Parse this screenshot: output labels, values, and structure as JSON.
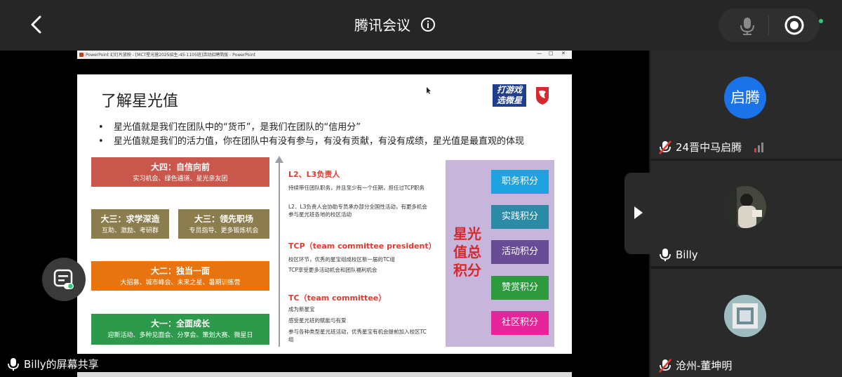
{
  "header": {
    "title": "腾讯会议"
  },
  "share_label": "Billy的屏幕共享",
  "ppt": {
    "window_title": "PowerPoint 幻灯片放映 - [MCT星光营2025招生-45-1105班]活动招聘简版 - PowerPoint",
    "slide": {
      "title": "了解星光值",
      "bullets": [
        "星光值就是我们在团队中的“货币”，是我们在团队的“信用分”",
        "星光值就是我们的活力值，你在团队中有没有参与，有没有贡献，有没有成绩，星光值是最直观的体现"
      ],
      "brand_text": [
        "打游戏",
        "选微星"
      ],
      "stages": [
        {
          "title": "大四：自信向前",
          "desc": "实习机会、绿色通道、星光亲友团",
          "color": "#c9574b"
        },
        {
          "title": "大三：求学深造",
          "desc": "互助、激励、考研群",
          "color": "#8c7d4e"
        },
        {
          "title": "大三：领先职场",
          "desc": "专员指导、更多锻炼机会",
          "color": "#8c7d4e"
        },
        {
          "title": "大二：独当一面",
          "desc": "大招募、城市峰会、未来之星、暑期训练营",
          "color": "#e8740f"
        },
        {
          "title": "大一：全面成长",
          "desc": "迎新活动、多种见面会、分享会、策划大赛、微星日",
          "color": "#2d9a4b"
        }
      ],
      "levels": [
        {
          "heading": "L2、L3负责人",
          "lines": [
            "持续带任团队职务，并且至少有一个任期，担任过TCP职务",
            "L2、L3负责人会协助专员承办部分全国性活动，有更多机会参与星光班各地的校区活动"
          ]
        },
        {
          "heading": "TCP（team committee president）",
          "lines": [
            "校区环节，优秀的星宝组成校区新一届的TC组",
            "TCP享受更多活动机会和团队福利机会"
          ]
        },
        {
          "heading": "TC（team committee）",
          "lines": [
            "成为新星宝",
            "感受星光班的赋能与有爱",
            "参与各种类型星光班活动，优秀星宝有机会提前加入校区TC组"
          ]
        }
      ],
      "panel_title": "星光值总积分",
      "points": [
        {
          "label": "职务积分",
          "color": "#1fa3e0"
        },
        {
          "label": "实践积分",
          "color": "#2b8aa6"
        },
        {
          "label": "活动积分",
          "color": "#6a4c96"
        },
        {
          "label": "赞赏积分",
          "color": "#2e9a3e"
        },
        {
          "label": "社区积分",
          "color": "#e6259a"
        }
      ]
    }
  },
  "participants": [
    {
      "name": "24晋中马启腾",
      "avatar_text": "启腾",
      "muted": true
    },
    {
      "name": "Billy",
      "muted": false
    },
    {
      "name": "沧州-董坤明",
      "muted": true
    }
  ],
  "icons": {
    "back": "chevron-left-icon",
    "info": "info-icon",
    "mic": "mic-icon",
    "record": "record-icon",
    "expand": "play-right-icon",
    "float": "chat-toggle-icon"
  }
}
